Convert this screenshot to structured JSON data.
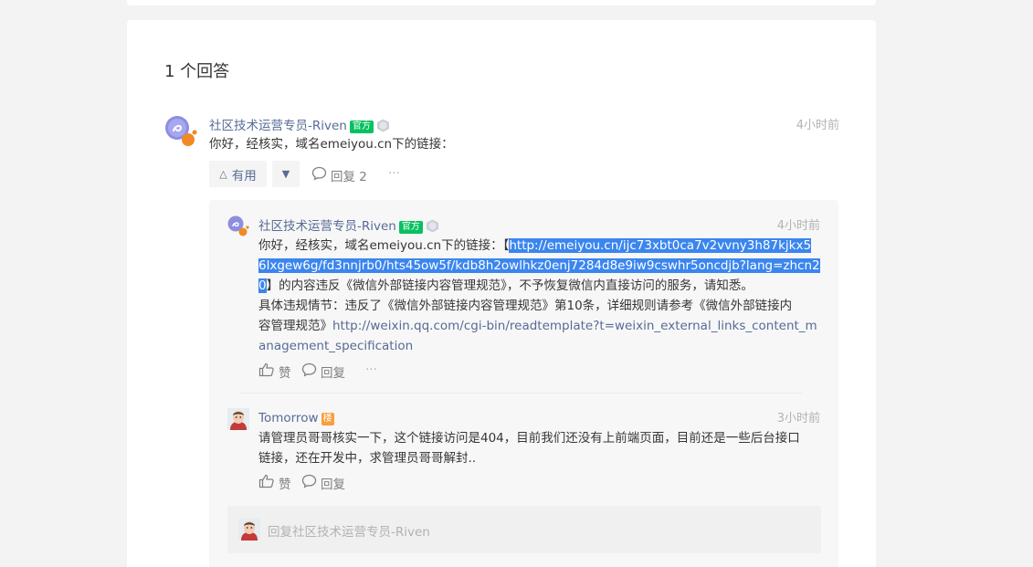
{
  "answer_count_label": "1 个回答",
  "main_answer": {
    "author": "社区技术运营专员-Riven",
    "badge": "官方",
    "time": "4小时前",
    "content": "你好，经核实，域名emeiyou.cn下的链接：",
    "useful_label": "有用",
    "reply_label": "回复 2",
    "more": "···"
  },
  "replies": [
    {
      "author": "社区技术运营专员-Riven",
      "badge": "官方",
      "time": "4小时前",
      "line1_prefix": "你好，经核实，域名emeiyou.cn下的链接：【",
      "link_part1": "http://emeiyou.cn/ijc73xbt0ca7v2vvny3h87kjkx5",
      "link_part2": "6lxgew6g/fd3nnjrb0/hts45ow5f/kdb8h2owlhkz0enj7284d8e9iw9cswhr5oncdjb?lang=zhcn2",
      "link_part3": "0",
      "line3_suffix": "】的内容违反《微信外部链接内容管理规范》，不予恢复微信内直接访问的服务，请知悉。",
      "line4": "具体违规情节：违反了《微信外部链接内容管理规范》第10条，详细规则请参考《微信外部链接内",
      "line5_prefix": "容管理规范》",
      "rule_link_part1": "http://weixin.qq.com/cgi-bin/readtemplate?t=weixin_external_links_content_m",
      "rule_link_part2": "anagement_specification",
      "like_label": "赞",
      "reply_label": "回复",
      "more": "···"
    },
    {
      "author": "Tomorrow",
      "badge": "楼",
      "time": "3小时前",
      "line1": "请管理员哥哥核实一下，这个链接访问是404，目前我们还没有上前端页面，目前还是一些后台接口",
      "line2": "链接，还在开发中，求管理员哥哥解封..",
      "like_label": "赞",
      "reply_label": "回复"
    }
  ],
  "reply_input": {
    "placeholder": "回复社区技术运营专员-Riven"
  },
  "colors": {
    "link": "#576b95",
    "official_badge": "#07c160",
    "floor_badge": "#fa9d3b",
    "selection": "#3b86ee"
  }
}
